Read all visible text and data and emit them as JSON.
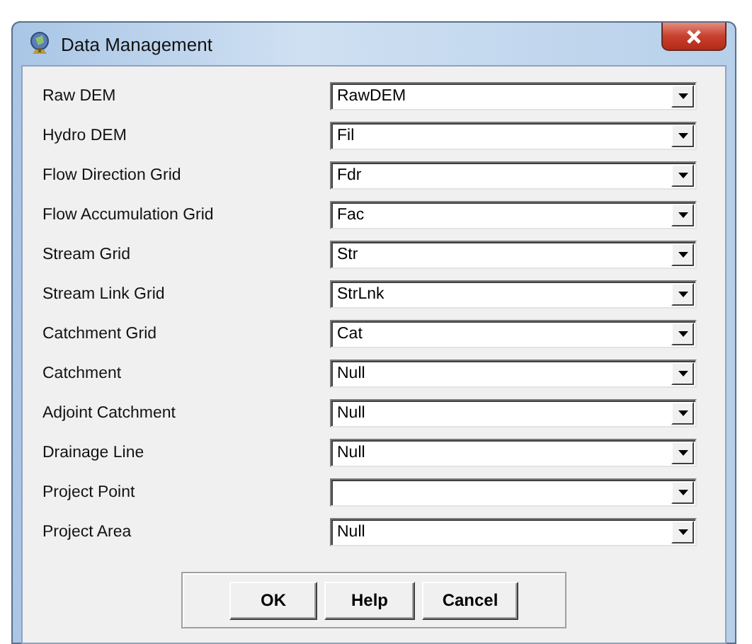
{
  "window": {
    "title": "Data Management"
  },
  "fields": [
    {
      "label": "Raw DEM",
      "value": "RawDEM"
    },
    {
      "label": "Hydro DEM",
      "value": "Fil"
    },
    {
      "label": "Flow Direction Grid",
      "value": "Fdr"
    },
    {
      "label": "Flow Accumulation Grid",
      "value": "Fac"
    },
    {
      "label": "Stream Grid",
      "value": "Str"
    },
    {
      "label": "Stream Link Grid",
      "value": "StrLnk"
    },
    {
      "label": "Catchment Grid",
      "value": "Cat"
    },
    {
      "label": "Catchment",
      "value": "Null"
    },
    {
      "label": "Adjoint Catchment",
      "value": "Null"
    },
    {
      "label": "Drainage Line",
      "value": "Null"
    },
    {
      "label": "Project Point"
    },
    {
      "label": "Project Area",
      "value": "Null"
    }
  ],
  "buttons": [
    "OK",
    "Help",
    "Cancel"
  ]
}
